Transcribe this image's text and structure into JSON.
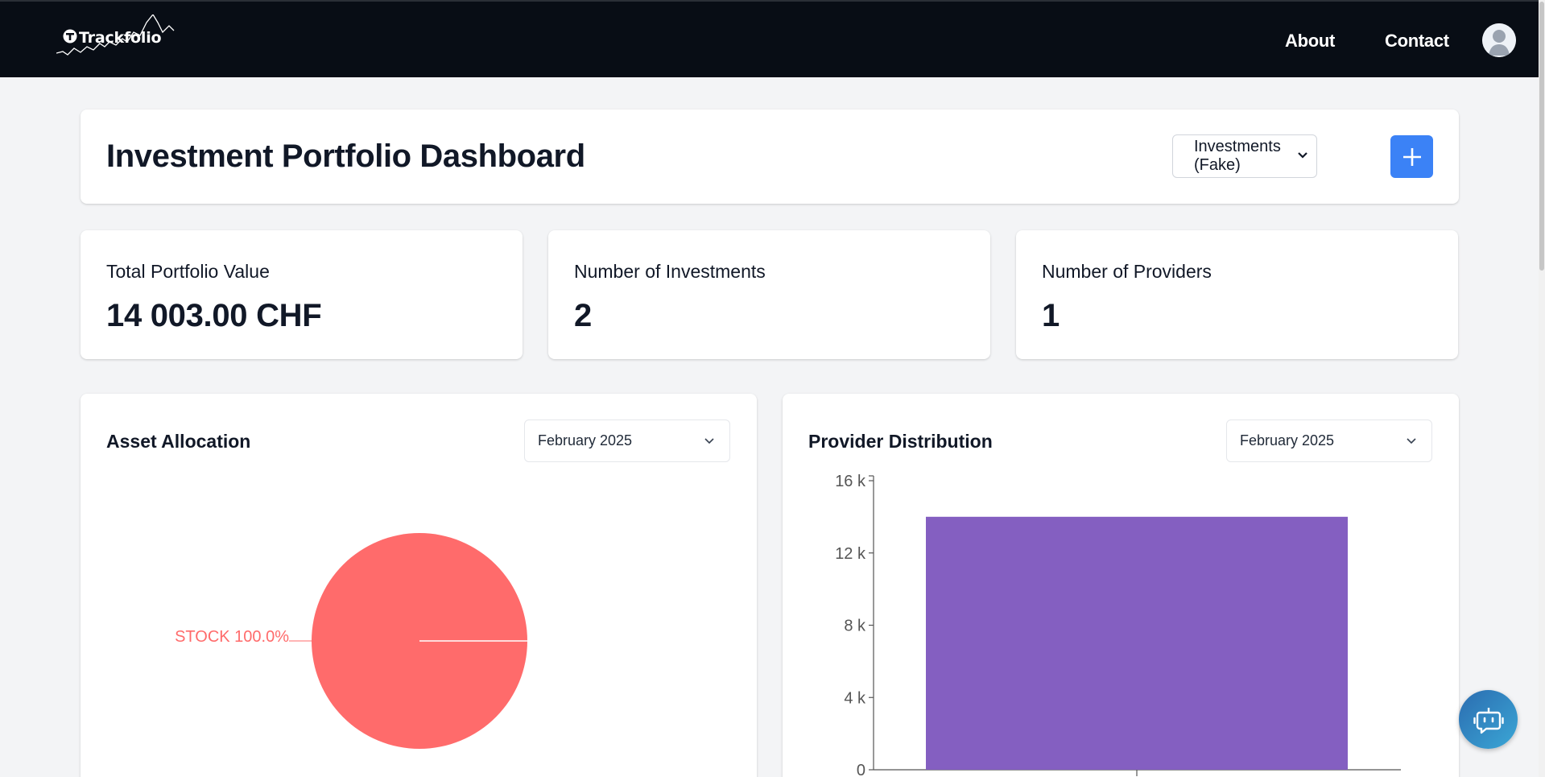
{
  "nav": {
    "brand": "Trackfolio",
    "links": [
      "About",
      "Contact"
    ]
  },
  "header": {
    "title": "Investment Portfolio Dashboard",
    "portfolio_selected": "Investments (Fake)",
    "add_label": "+"
  },
  "stats": [
    {
      "label": "Total Portfolio Value",
      "value": "14 003.00 CHF"
    },
    {
      "label": "Number of Investments",
      "value": "2"
    },
    {
      "label": "Number of Providers",
      "value": "1"
    }
  ],
  "asset_allocation": {
    "title": "Asset Allocation",
    "month": "February 2025"
  },
  "provider_distribution": {
    "title": "Provider Distribution",
    "month": "February 2025"
  },
  "colors": {
    "nav_bg": "#080d15",
    "accent": "#3b82f6",
    "pie_stock": "#ff6b6b",
    "bar": "#845fc1"
  },
  "icons": {
    "add": "plus-icon",
    "avatar": "user-avatar-icon",
    "chat": "robot-chat-icon",
    "dropdown": "chevron-down-icon"
  },
  "chart_data": [
    {
      "type": "pie",
      "title": "Asset Allocation",
      "categories": [
        "STOCK"
      ],
      "values": [
        100.0
      ],
      "labels": [
        "STOCK 100.0%"
      ],
      "colors": [
        "#ff6b6b"
      ]
    },
    {
      "type": "bar",
      "title": "Provider Distribution",
      "categories": [
        ""
      ],
      "values": [
        14003
      ],
      "ylim": [
        0,
        16000
      ],
      "yticks": [
        0,
        4000,
        8000,
        12000,
        16000
      ],
      "ytick_labels": [
        "0",
        "4 k",
        "8 k",
        "12 k",
        "16 k"
      ],
      "colors": [
        "#845fc1"
      ]
    }
  ]
}
